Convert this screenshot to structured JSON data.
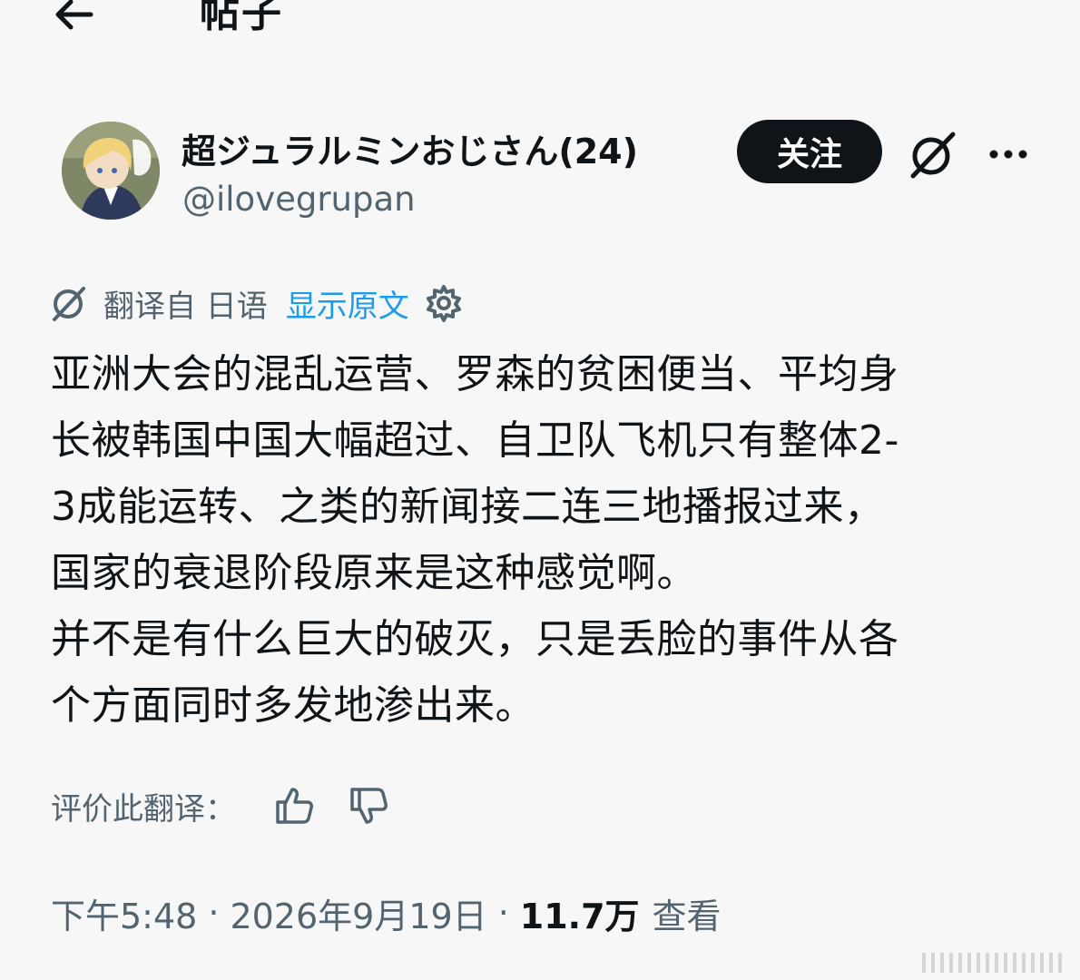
{
  "header": {
    "title": "帖子"
  },
  "author": {
    "display_name": "超ジュラルミンおじさん(24)",
    "handle": "@ilovegrupan",
    "follow_label": "关注"
  },
  "translation": {
    "translated_from": "翻译自 日语",
    "show_original": "显示原文"
  },
  "post": {
    "lines": [
      "亚洲大会的混乱运营、罗森的贫困便当、平均身",
      "长被韩国中国大幅超过、自卫队飞机只有整体2-",
      "3成能运转、之类的新闻接二连三地播报过来，",
      "国家的衰退阶段原来是这种感觉啊。",
      "并不是有什么巨大的破灭，只是丢脸的事件从各",
      "个方面同时多发地渗出来。"
    ]
  },
  "rating": {
    "label": "评价此翻译："
  },
  "meta": {
    "time": "下午5:48",
    "date": "2026年9月19日",
    "separator": "·",
    "views_count": "11.7万",
    "views_label": "查看"
  },
  "colors": {
    "background": "#f7f7f7",
    "text": "#0f1419",
    "secondary": "#536471",
    "link": "#1d9bf0",
    "follow_bg": "#0f1419"
  }
}
